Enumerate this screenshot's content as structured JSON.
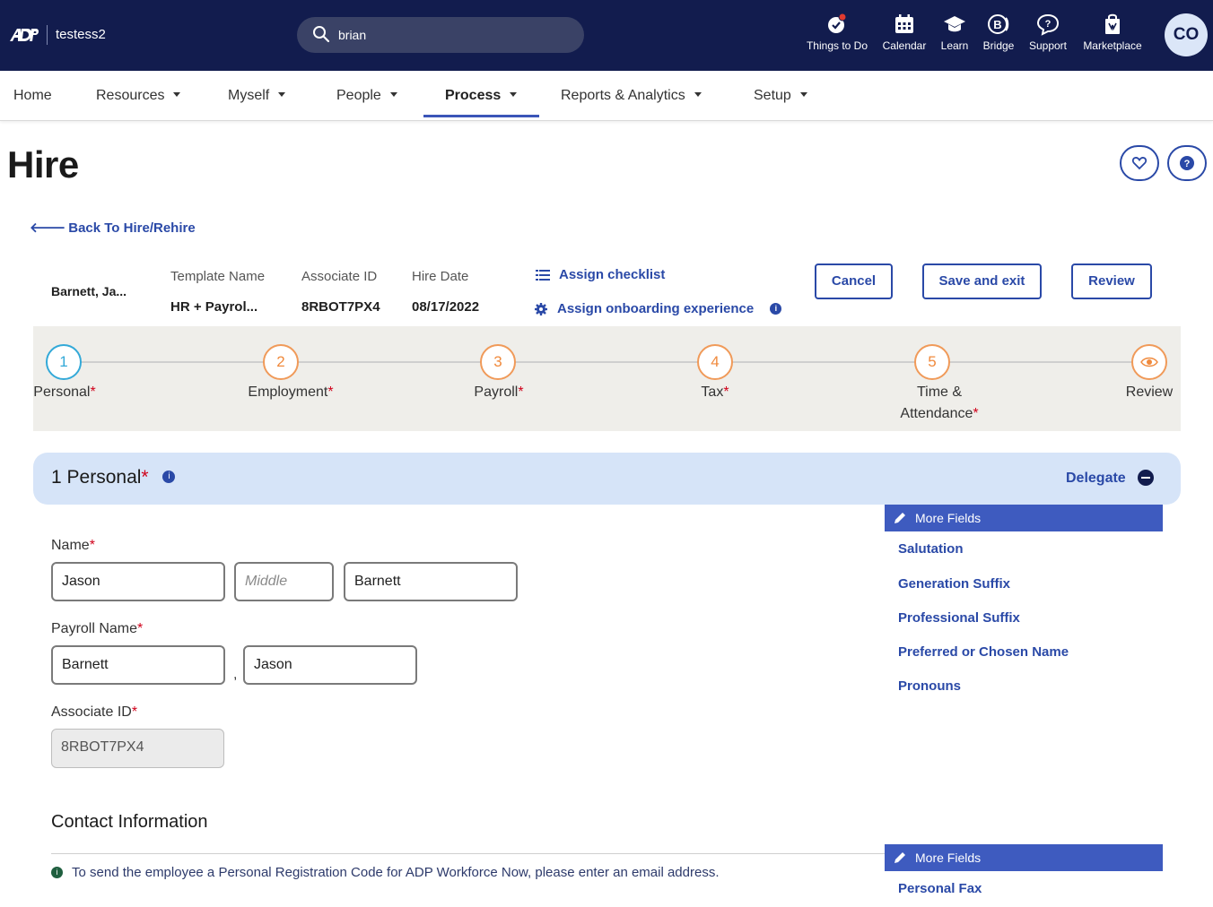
{
  "topbar": {
    "tenant": "testess2",
    "search_value": "brian",
    "nav_icons": [
      {
        "label": "Things to Do",
        "icon": "check-badge-icon"
      },
      {
        "label": "Calendar",
        "icon": "calendar-icon"
      },
      {
        "label": "Learn",
        "icon": "graduation-cap-icon"
      },
      {
        "label": "Bridge",
        "icon": "bridge-icon"
      },
      {
        "label": "Support",
        "icon": "chat-question-icon"
      },
      {
        "label": "Marketplace",
        "icon": "shopping-bag-icon"
      }
    ],
    "avatar": "CO"
  },
  "mainnav": {
    "items": [
      "Home",
      "Resources",
      "Myself",
      "People",
      "Process",
      "Reports & Analytics",
      "Setup"
    ],
    "active": "Process"
  },
  "page": {
    "title": "Hire",
    "back_link": "Back To Hire/Rehire"
  },
  "summary": {
    "name": "Barnett, Ja...",
    "template_label": "Template Name",
    "template_value": "HR + Payrol...",
    "associate_label": "Associate ID",
    "associate_value": "8RBOT7PX4",
    "hire_label": "Hire Date",
    "hire_value": "08/17/2022",
    "assign_checklist": "Assign checklist",
    "assign_onboarding": "Assign onboarding experience",
    "cancel": "Cancel",
    "save_exit": "Save and exit",
    "review": "Review"
  },
  "stepper": {
    "steps": [
      {
        "num": "1",
        "label": "Personal",
        "required": true
      },
      {
        "num": "2",
        "label": "Employment",
        "required": true
      },
      {
        "num": "3",
        "label": "Payroll",
        "required": true
      },
      {
        "num": "4",
        "label": "Tax",
        "required": true
      },
      {
        "num": "5",
        "label_line1": "Time &",
        "label_line2": "Attendance",
        "required": true
      },
      {
        "num": "",
        "label": "Review",
        "required": false
      }
    ]
  },
  "section": {
    "number": "1",
    "title": "Personal",
    "delegate": "Delegate"
  },
  "form": {
    "name_label": "Name",
    "first_name": "Jason",
    "middle_placeholder": "Middle",
    "last_name": "Barnett",
    "payroll_label": "Payroll Name",
    "payroll_last": "Barnett",
    "payroll_first": "Jason",
    "associate_label": "Associate ID",
    "associate_value": "8RBOT7PX4"
  },
  "more_fields": {
    "header": "More Fields",
    "items": [
      "Salutation",
      "Generation Suffix",
      "Professional Suffix",
      "Preferred or Chosen Name",
      "Pronouns"
    ]
  },
  "contact": {
    "title": "Contact Information",
    "note": "To send the employee a Personal Registration Code for ADP Workforce Now, please enter an email address.",
    "more_header": "More Fields",
    "more_items": [
      "Personal Fax"
    ]
  },
  "colors": {
    "topbar": "#121c4e",
    "accent": "#2a49a7",
    "step_done": "#f09a59",
    "step_current": "#33a9d8",
    "required": "#d0021b"
  }
}
